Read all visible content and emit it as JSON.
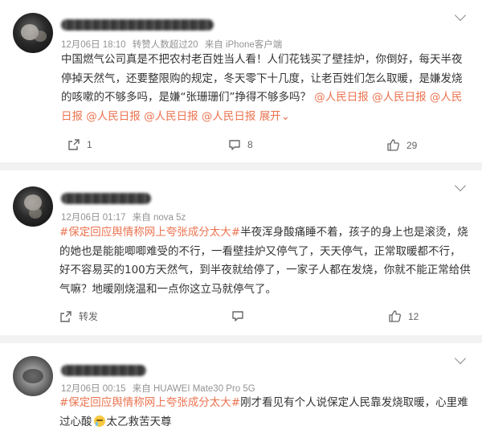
{
  "posts": [
    {
      "meta": {
        "date": "12月06日 18:10",
        "likes_note": "转赞人数超过20",
        "source": "来自 iPhone客户端"
      },
      "content": {
        "text": "中国燃气公司真是不把农村老百姓当人看！人们花钱买了壁挂炉，你倒好，每天半夜停掉天然气，还要整限购的规定，冬天零下十几度，让老百姓们怎么取暖，是嫌发烧的咳嗽的不够多吗，是嫌“张珊珊们”挣得不够多吗？",
        "mentions": [
          "@人民日报",
          "@人民日报",
          "@人民日报",
          "@人民日报",
          "@人民日报",
          "@人民日报"
        ],
        "expand": "展开"
      },
      "actions": {
        "repost": "1",
        "comment": "8",
        "like": "29"
      }
    },
    {
      "meta": {
        "date": "12月06日 01:17",
        "source": "来自 nova 5z"
      },
      "content": {
        "hashtag": "#保定回应舆情称网上夸张成分太大#",
        "text": "半夜浑身酸痛睡不着，孩子的身上也是滚烫，烧的她也是能能唧唧难受的不行，一看壁挂炉又停气了，天天停气，正常取暖都不行，好不容易买的100方天然气，到半夜就给停了，一家子人都在发烧，你就不能正常给供气嘛？地暖刚烧温和一点你这立马就停气了。"
      },
      "actions": {
        "repost": "转发",
        "comment": "",
        "like": "12"
      }
    },
    {
      "meta": {
        "date": "12月06日 00:15",
        "source": "来自 HUAWEI Mate30 Pro 5G"
      },
      "content": {
        "hashtag": "#保定回应舆情称网上夸张成分太大#",
        "text": "刚才看见有个人说保定人民靠发烧取暖，心里难过心酸",
        "emoji": "crying-face-emoji",
        "tail": "太乙救苦天尊"
      }
    }
  ],
  "colors": {
    "link": "#eb7350",
    "meta": "#939393",
    "text": "#333333",
    "separator": "#f2f2f2"
  }
}
